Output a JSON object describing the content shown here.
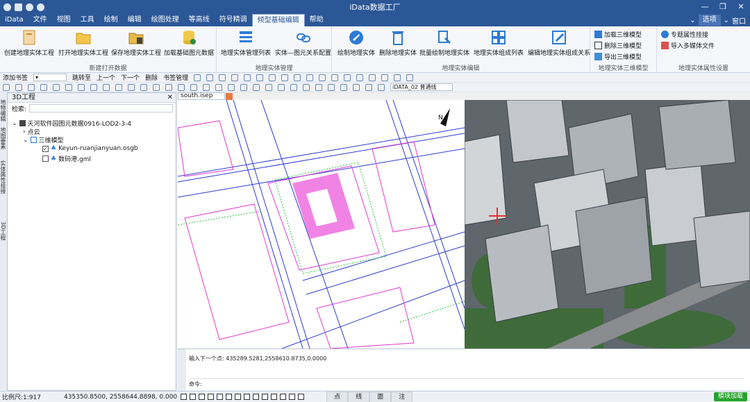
{
  "app": {
    "title": "iData数据工厂",
    "logo": "iData"
  },
  "window": {
    "minimize": "—",
    "restore": "❐",
    "close": "✕"
  },
  "menu": {
    "items": [
      "文件",
      "视图",
      "工具",
      "绘制",
      "编辑",
      "绘图处理",
      "等高线",
      "符号精调",
      "倾型基础编辑",
      "帮助"
    ],
    "active_index": 8,
    "options": "选项",
    "window": "窗口"
  },
  "ribbon": {
    "groups": [
      {
        "title": "新建打开数据",
        "buttons": [
          "创建地理实体工程",
          "打开地理实体工程",
          "保存地理实体工程",
          "加载基础图元数据"
        ]
      },
      {
        "title": "地理实体管理",
        "buttons": [
          "地理实体管理列表",
          "实体—图元关系配置"
        ]
      },
      {
        "title": "地理实体编辑",
        "buttons": [
          "绘制地理实体",
          "删除地理实体",
          "批量绘制地理实体",
          "地理实体组成列表",
          "编辑地理实体组成关系"
        ]
      },
      {
        "title": "地理实体三维模型",
        "buttons": [
          "加载三维模型",
          "删除三维模型",
          "导出三维模型"
        ]
      },
      {
        "title": "地理实体属性设置",
        "buttons": [
          "专题属性挂接",
          "导入多媒体文件"
        ]
      }
    ]
  },
  "bookmark_bar": {
    "add": "添加书签",
    "goto": "跳转至",
    "prev": "上一个",
    "next": "下一个",
    "delete": "删除",
    "manage": "书签管理"
  },
  "layer_select": {
    "value": "iDATA_02 普通线"
  },
  "panel": {
    "title": "3D工程",
    "search_label": "检索:",
    "close": "✕",
    "pin": "ᚔ"
  },
  "tree": {
    "root": "天河软件园图元数据0916-LOD2-3-4",
    "pointcloud": "点云",
    "model": "三维模型",
    "item1": "Keyun-ruanjianyuan.osgb",
    "item2": "数码港.gml"
  },
  "vtabs": [
    "地物编辑",
    "地图要素",
    "实体属性挂接",
    "3D工程"
  ],
  "view": {
    "tab": "south.isep",
    "north": "N"
  },
  "command": {
    "line1": "输入下一个点: 435289.5281,2558610.8735,0.0000",
    "line2": "命令:"
  },
  "status": {
    "scale": "比例尺:1:917",
    "coords": "435350.8500, 2558644.8898, 0.000",
    "snaps": [
      "点",
      "线",
      "面",
      "注"
    ],
    "loading": "模块加载"
  }
}
